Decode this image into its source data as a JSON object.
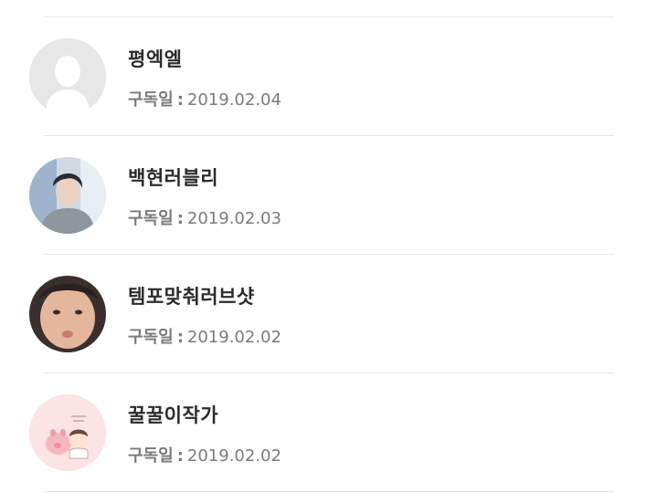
{
  "subscribers": {
    "date_label": "구독일",
    "separator": ":",
    "items": [
      {
        "name": "평엑엘",
        "date": "2019.02.04",
        "avatar": "default-profile-placeholder"
      },
      {
        "name": "백현러블리",
        "date": "2019.02.03",
        "avatar": "profile-photo"
      },
      {
        "name": "템포맞춰러브샷",
        "date": "2019.02.02",
        "avatar": "profile-photo"
      },
      {
        "name": "꿀꿀이작가",
        "date": "2019.02.02",
        "avatar": "pig-illustration"
      }
    ]
  }
}
